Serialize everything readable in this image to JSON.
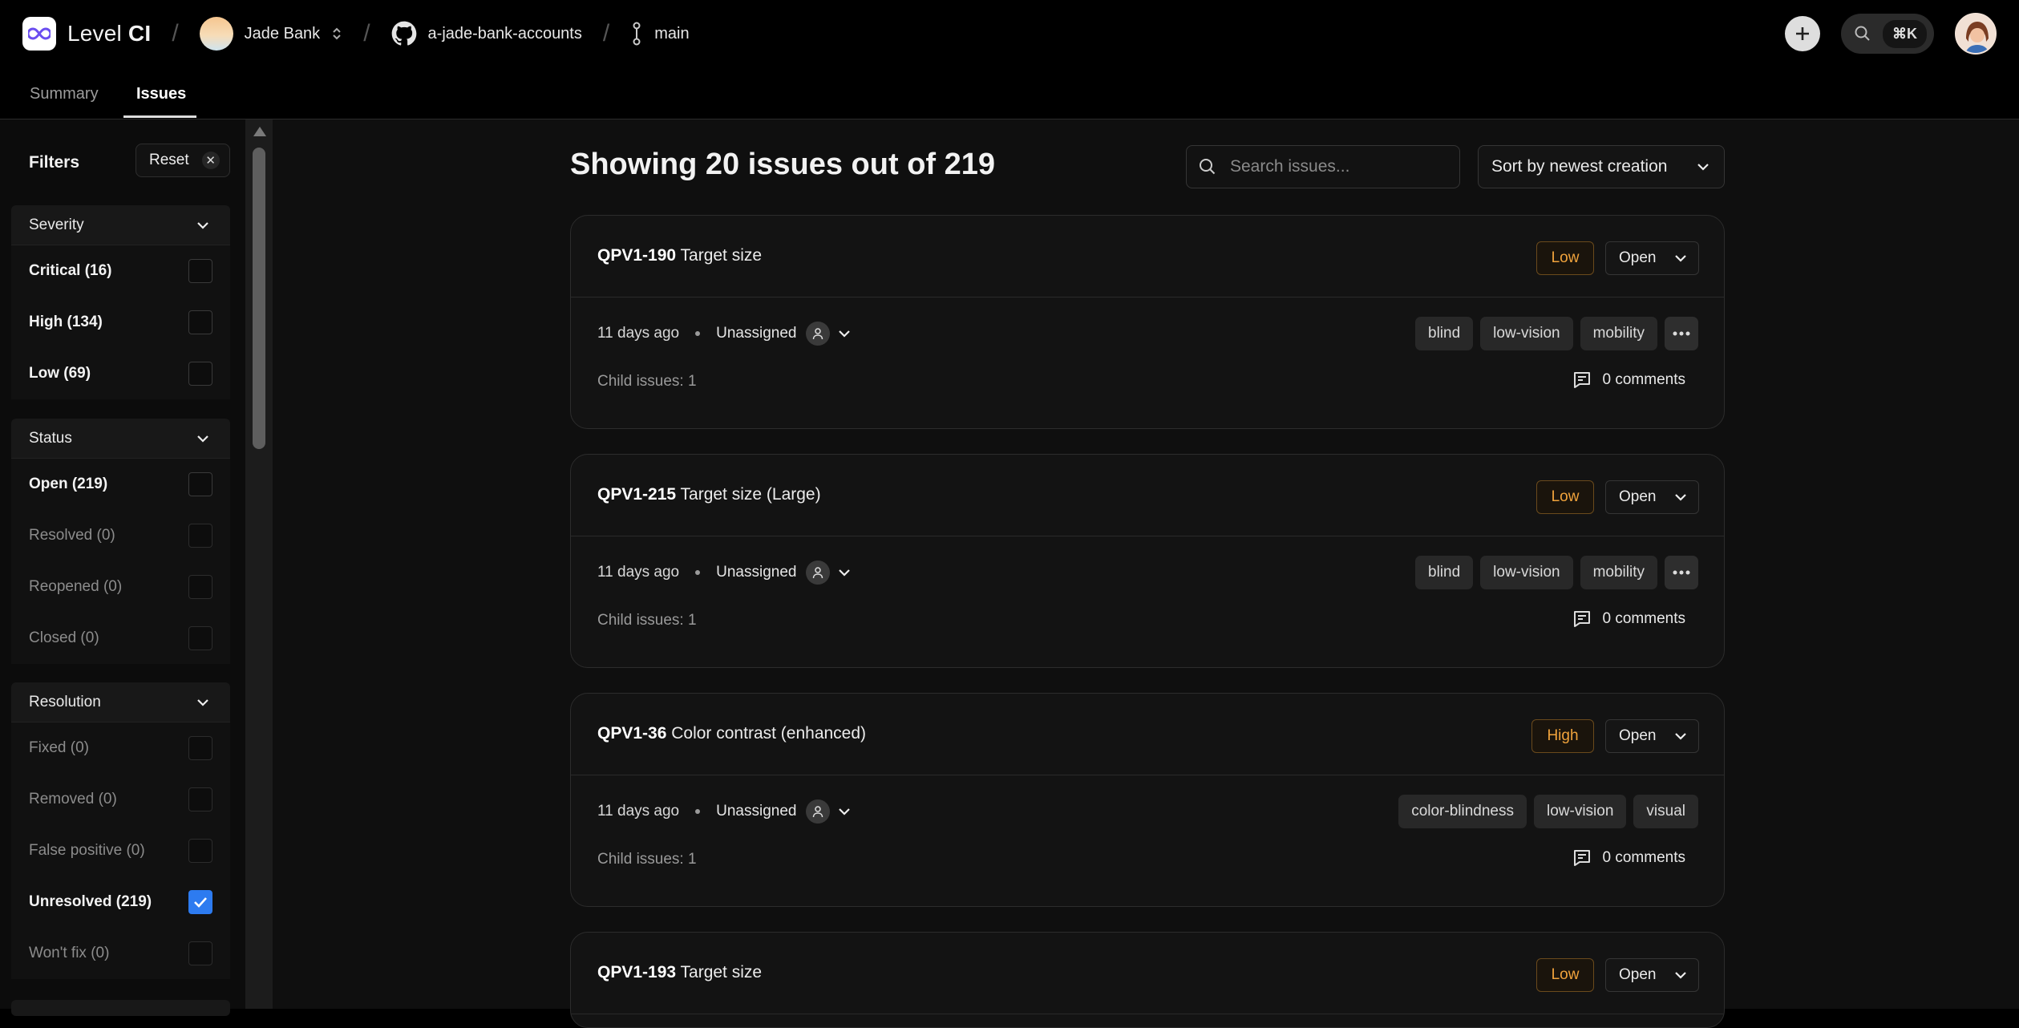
{
  "header": {
    "brand_prefix": "Level",
    "brand_bold": "CI",
    "org": "Jade Bank",
    "repo": "a-jade-bank-accounts",
    "branch": "main",
    "shortcut": "⌘K"
  },
  "tabs": [
    "Summary",
    "Issues"
  ],
  "filters": {
    "title": "Filters",
    "reset_label": "Reset",
    "groups": [
      {
        "title": "Severity",
        "options": [
          {
            "label": "Critical (16)",
            "checked": false
          },
          {
            "label": "High (134)",
            "checked": false
          },
          {
            "label": "Low (69)",
            "checked": false
          }
        ]
      },
      {
        "title": "Status",
        "options": [
          {
            "label": "Open (219)",
            "checked": false
          },
          {
            "label": "Resolved (0)",
            "checked": false
          },
          {
            "label": "Reopened (0)",
            "checked": false
          },
          {
            "label": "Closed (0)",
            "checked": false
          }
        ]
      },
      {
        "title": "Resolution",
        "options": [
          {
            "label": "Fixed (0)",
            "checked": false
          },
          {
            "label": "Removed (0)",
            "checked": false
          },
          {
            "label": "False positive (0)",
            "checked": false
          },
          {
            "label": "Unresolved (219)",
            "checked": true
          },
          {
            "label": "Won't fix (0)",
            "checked": false
          }
        ]
      }
    ]
  },
  "main": {
    "heading": "Showing 20 issues out of 219",
    "search_placeholder": "Search issues...",
    "sort_label": "Sort by newest creation"
  },
  "issues": [
    {
      "id": "QPV1-190",
      "title": "Target size",
      "severity": "Low",
      "status": "Open",
      "age": "11 days ago",
      "assignee": "Unassigned",
      "tags": [
        "blind",
        "low-vision",
        "mobility"
      ],
      "has_more": true,
      "child": "Child issues: 1",
      "comments": "0 comments"
    },
    {
      "id": "QPV1-215",
      "title": "Target size (Large)",
      "severity": "Low",
      "status": "Open",
      "age": "11 days ago",
      "assignee": "Unassigned",
      "tags": [
        "blind",
        "low-vision",
        "mobility"
      ],
      "has_more": true,
      "child": "Child issues: 1",
      "comments": "0 comments"
    },
    {
      "id": "QPV1-36",
      "title": "Color contrast (enhanced)",
      "severity": "High",
      "status": "Open",
      "age": "11 days ago",
      "assignee": "Unassigned",
      "tags": [
        "color-blindness",
        "low-vision",
        "visual"
      ],
      "has_more": false,
      "child": "Child issues: 1",
      "comments": "0 comments"
    },
    {
      "id": "QPV1-193",
      "title": "Target size",
      "severity": "Low",
      "status": "Open",
      "age": "",
      "assignee": "",
      "tags": [],
      "has_more": false,
      "child": "",
      "comments": ""
    }
  ],
  "colors": {
    "accent": "#2d7bf0",
    "severity_text": "#f0a33c"
  }
}
